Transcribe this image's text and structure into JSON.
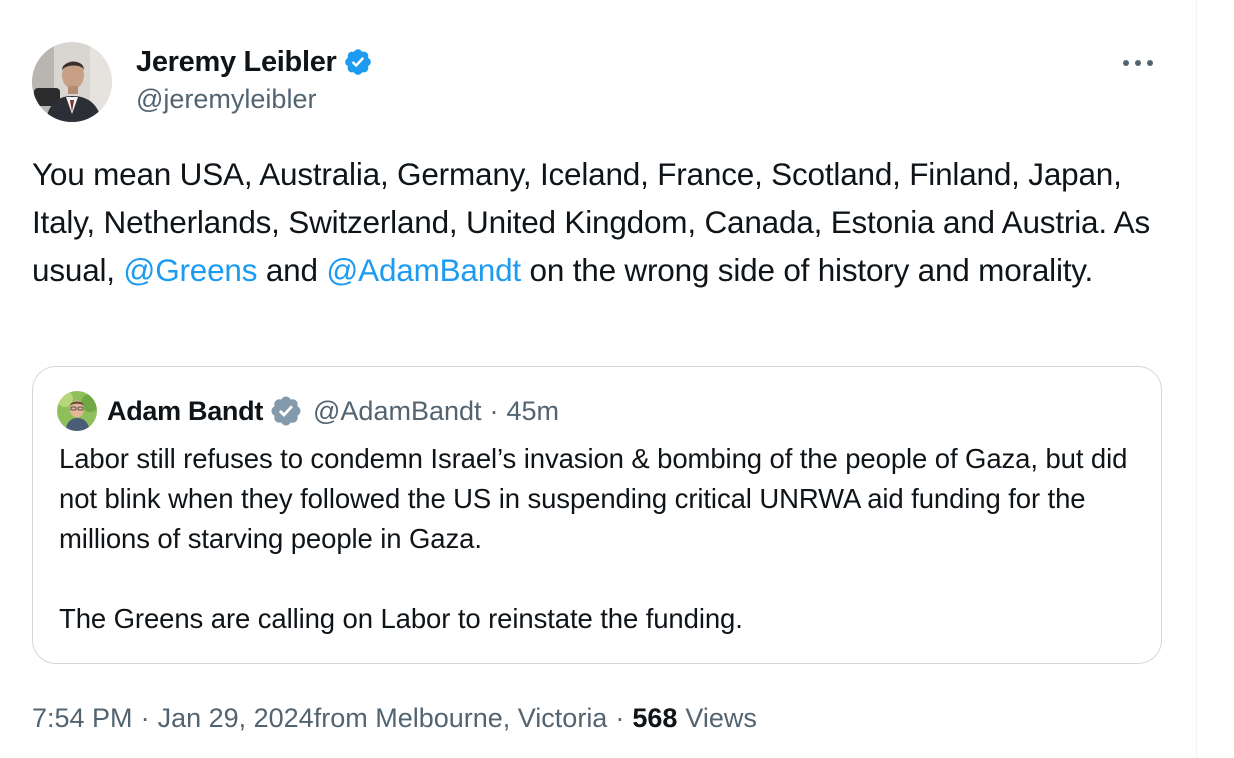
{
  "author": {
    "display_name": "Jeremy Leibler",
    "handle": "@jeremyleibler"
  },
  "tweet": {
    "text_1": "You mean USA, Australia, Germany, Iceland, France, Scotland, Finland, Japan, Italy, Netherlands, Switzerland, United Kingdom, Canada, Estonia and Austria. As usual, ",
    "mention_1": "@Greens",
    "text_2": " and ",
    "mention_2": "@AdamBandt",
    "text_3": " on the wrong side of history and morality."
  },
  "quote": {
    "display_name": "Adam Bandt",
    "handle": "@AdamBandt",
    "separator": "·",
    "time": "45m",
    "paragraph_1": "Labor still refuses to condemn Israel’s invasion & bombing of the people of Gaza, but did not blink when they followed the US in suspending critical UNRWA aid funding for the millions of starving people in Gaza.",
    "paragraph_2": "The Greens are calling on Labor to reinstate the funding."
  },
  "meta": {
    "time": "7:54 PM",
    "dot_1": "·",
    "date": "Jan 29, 2024",
    "location": " from Melbourne, Victoria",
    "dot_2": "·",
    "views_count": "568",
    "views_label": "Views"
  },
  "icons": {
    "author_badge": "verified-badge-icon",
    "quote_badge": "government-badge-icon",
    "more": "more-horizontal-icon"
  },
  "colors": {
    "link": "#1d9bf0",
    "verified_blue": "#1d9bf0",
    "government_gray": "#829aab",
    "secondary_text": "#536471",
    "border": "#cfd9de"
  }
}
